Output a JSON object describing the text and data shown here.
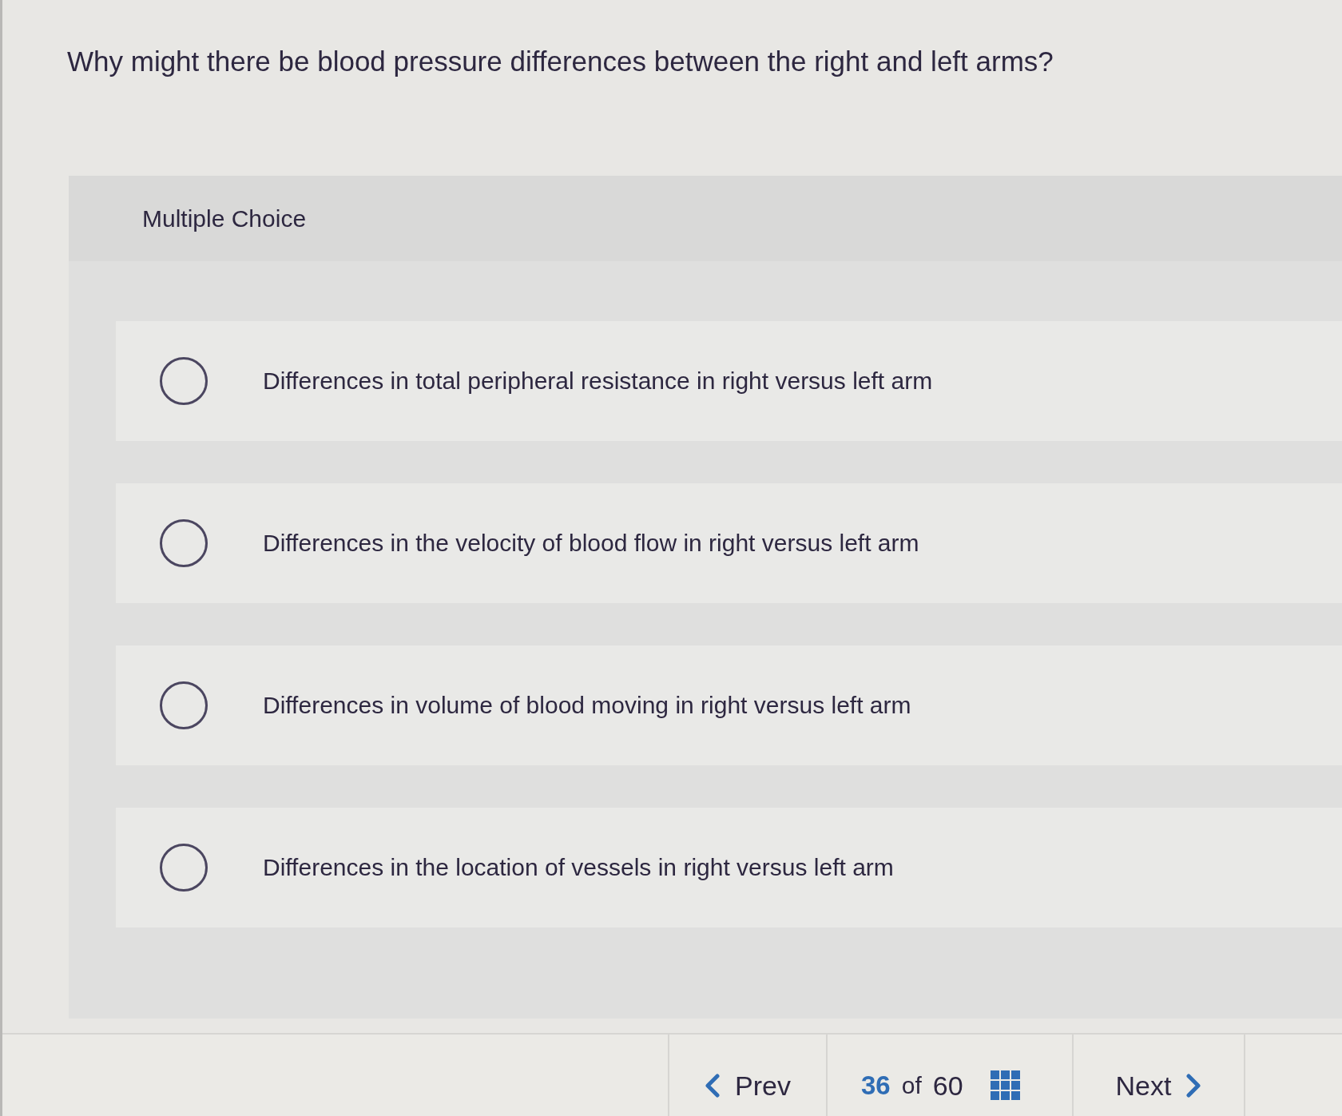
{
  "question": "Why might there be blood pressure differences between the right and left arms?",
  "answer_panel": {
    "type_label": "Multiple Choice",
    "options": [
      {
        "text": "Differences in total peripheral resistance in right versus left arm",
        "selected": false
      },
      {
        "text": "Differences in the velocity of blood flow in right versus left arm",
        "selected": false
      },
      {
        "text": "Differences in volume of blood moving in right versus left arm",
        "selected": false
      },
      {
        "text": "Differences in the location of vessels in right versus left arm",
        "selected": false
      }
    ]
  },
  "navigation": {
    "prev_label": "Prev",
    "current": "36",
    "of_label": "of",
    "total": "60",
    "next_label": "Next"
  }
}
